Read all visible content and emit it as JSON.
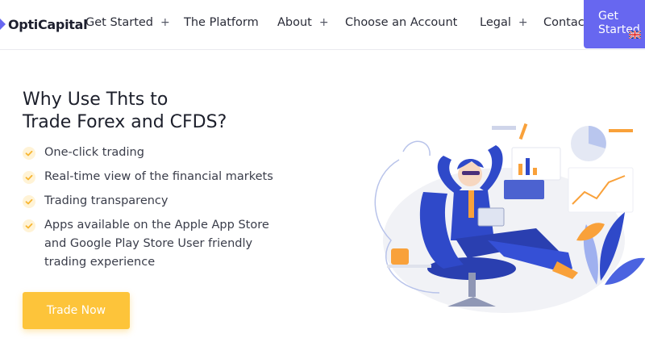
{
  "header": {
    "logo_text": "OptiCapital",
    "nav": [
      {
        "label": "Get Started",
        "has_submenu": true
      },
      {
        "label": "The Platform",
        "has_submenu": false
      },
      {
        "label": "About",
        "has_submenu": true
      },
      {
        "label": "Choose an Account",
        "has_submenu": false
      },
      {
        "label": "Legal",
        "has_submenu": true
      },
      {
        "label": "Contact Us",
        "has_submenu": false
      }
    ],
    "plus_glyph": "+",
    "cta_line1": "Get",
    "cta_line2": "Started",
    "language_icon": "uk-flag-icon"
  },
  "hero": {
    "title_line1": "Why Use Thts to",
    "title_line2": "Trade Forex and CFDS?",
    "features": [
      {
        "lines": [
          "One-click trading"
        ]
      },
      {
        "lines": [
          "Real-time view of the financial markets"
        ]
      },
      {
        "lines": [
          "Trading transparency"
        ]
      },
      {
        "lines": [
          "Apps available on the Apple App Store",
          "and Google Play Store User friendly",
          "trading experience"
        ]
      }
    ],
    "button_label": "Trade Now",
    "check_icon": "check-icon"
  },
  "colors": {
    "accent": "#6767f0",
    "button": "#fdc43a",
    "check_bg": "#fff3d6",
    "check_fg": "#f7b531",
    "illustration_blue": "#2f49c9",
    "illustration_orange": "#f9a13a"
  }
}
